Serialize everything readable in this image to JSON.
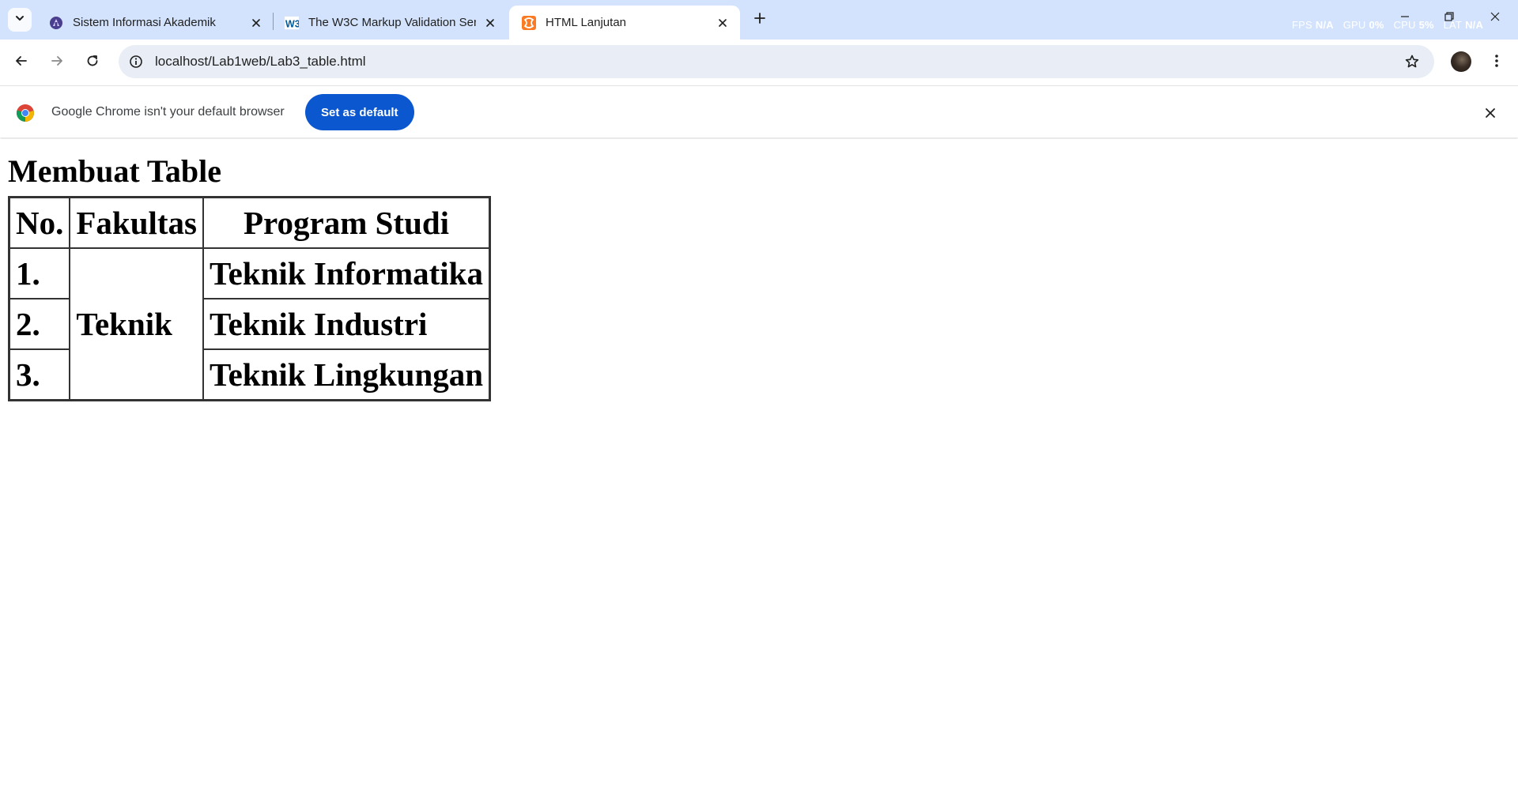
{
  "browser": {
    "tabs": [
      {
        "title": "Sistem Informasi Akademik",
        "favicon": "university-icon",
        "active": false
      },
      {
        "title": "The W3C Markup Validation Service",
        "favicon": "w3c-icon",
        "active": false
      },
      {
        "title": "HTML Lanjutan",
        "favicon": "xampp-icon",
        "active": true
      }
    ],
    "perf": {
      "fps_label": "FPS",
      "fps_value": "N/A",
      "gpu_label": "GPU",
      "gpu_value": "0%",
      "cpu_label": "CPU",
      "cpu_value": "5%",
      "lat_label": "LAT",
      "lat_value": "N/A"
    },
    "url": "localhost/Lab1web/Lab3_table.html",
    "infobar": {
      "message": "Google Chrome isn't your default browser",
      "button": "Set as default"
    }
  },
  "page": {
    "heading": "Membuat Table",
    "table": {
      "headers": [
        "No.",
        "Fakultas",
        "Program Studi"
      ],
      "faculty": "Teknik",
      "rows": [
        {
          "no": "1.",
          "program": "Teknik Informatika"
        },
        {
          "no": "2.",
          "program": "Teknik Industri"
        },
        {
          "no": "3.",
          "program": "Teknik Lingkungan"
        }
      ]
    }
  },
  "colors": {
    "tabstrip_bg": "#d3e3fd",
    "omnibox_bg": "#e9eef6",
    "primary_button": "#0b57d0"
  }
}
